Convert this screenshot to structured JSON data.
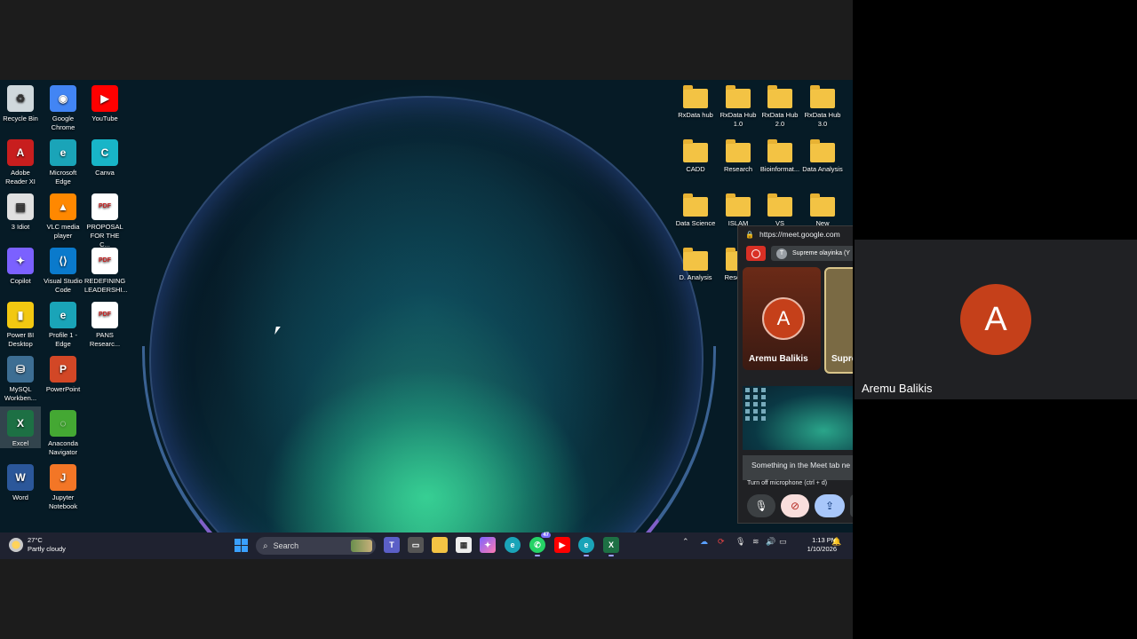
{
  "desktop": {
    "left_icons": [
      {
        "label": "Recycle Bin",
        "icon": "recycle-bin-icon",
        "color": "#cfd8dc"
      },
      {
        "label": "Google Chrome",
        "icon": "chrome-icon",
        "color": "#4285f4"
      },
      {
        "label": "YouTube",
        "icon": "youtube-icon",
        "color": "#ff0000"
      },
      {
        "label": "Adobe Reader XI",
        "icon": "adobe-reader-icon",
        "color": "#c81e1e"
      },
      {
        "label": "Microsoft Edge",
        "icon": "edge-icon",
        "color": "#1aa4b8"
      },
      {
        "label": "Canva",
        "icon": "canva-icon",
        "color": "#18b5c8"
      },
      {
        "label": "3 Idiot",
        "icon": "media-file-icon",
        "color": "#e0e0e0"
      },
      {
        "label": "VLC media player",
        "icon": "vlc-icon",
        "color": "#ff8800"
      },
      {
        "label": "PROPOSAL FOR THE C...",
        "icon": "pdf-icon",
        "color": "#ffffff"
      },
      {
        "label": "Copilot",
        "icon": "copilot-icon",
        "color": "#7b61ff"
      },
      {
        "label": "Visual Studio Code",
        "icon": "vscode-icon",
        "color": "#0a7acc"
      },
      {
        "label": "REDEFINING LEADERSHI...",
        "icon": "pdf-icon",
        "color": "#ffffff"
      },
      {
        "label": "Power BI Desktop",
        "icon": "powerbi-icon",
        "color": "#f2c811"
      },
      {
        "label": "Profile 1 - Edge",
        "icon": "edge-icon",
        "color": "#1aa4b8"
      },
      {
        "label": "PANS Researc...",
        "icon": "pdf-icon",
        "color": "#ffffff"
      },
      {
        "label": "MySQL Workben...",
        "icon": "mysql-icon",
        "color": "#3d6e93"
      },
      {
        "label": "PowerPoint",
        "icon": "powerpoint-icon",
        "color": "#d24726"
      },
      {
        "label": "Excel",
        "icon": "excel-icon",
        "color": "#1d7044"
      },
      {
        "label": "Anaconda Navigator",
        "icon": "anaconda-icon",
        "color": "#44a833"
      },
      {
        "label": "Word",
        "icon": "word-icon",
        "color": "#2b579a"
      },
      {
        "label": "Jupyter Notebook",
        "icon": "jupyter-icon",
        "color": "#f37626"
      }
    ],
    "right_icons": [
      {
        "label": "RxData hub"
      },
      {
        "label": "RxData Hub 1.0"
      },
      {
        "label": "RxData Hub 2.0"
      },
      {
        "label": "RxData Hub 3.0"
      },
      {
        "label": "CADD"
      },
      {
        "label": "Research"
      },
      {
        "label": "Bioinformat..."
      },
      {
        "label": "Data Analysis"
      },
      {
        "label": "Data Science"
      },
      {
        "label": "ISLAM"
      },
      {
        "label": "VS"
      },
      {
        "label": "New"
      },
      {
        "label": "D. Analysis"
      },
      {
        "label": "Rese Wri"
      }
    ]
  },
  "taskbar": {
    "weather_temp": "27°C",
    "weather_desc": "Partly cloudy",
    "search_placeholder": "Search",
    "whatsapp_badge": "47",
    "time": "1:13 PM",
    "date": "1/10/2026"
  },
  "meet_popup": {
    "url": "https://meet.google.com",
    "presenter_initial": "T",
    "presenter_label": "Supreme olayinka (Y",
    "tile1_initial": "A",
    "tile1_name": "Aremu Balikis",
    "tile2_name": "Supre",
    "toast": "Something in the Meet tab ne",
    "tooltip": "Turn off microphone (ctrl + d)"
  },
  "side_panel": {
    "avatar_initial": "A",
    "participant_name": "Aremu Balikis",
    "avatar_color": "#c5401a"
  }
}
